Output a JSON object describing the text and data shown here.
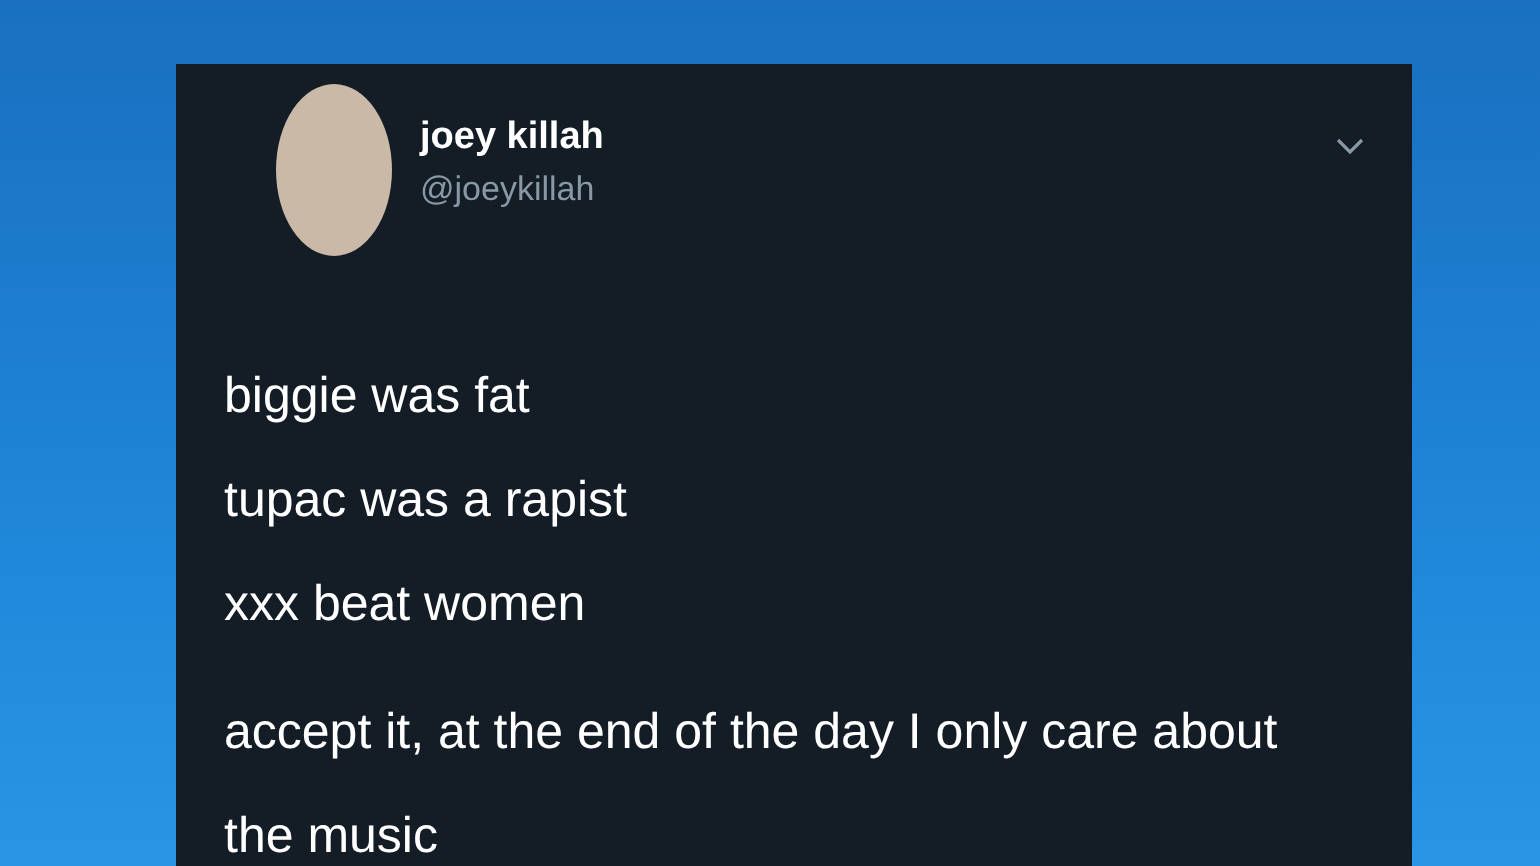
{
  "tweet": {
    "author": {
      "name": "joey killah",
      "handle": "@joeykillah"
    },
    "paragraphs": [
      {
        "lines": [
          "biggie was fat",
          "tupac was a rapist",
          "xxx beat women"
        ]
      },
      {
        "lines": [
          "accept it, at the end of the day I only care about the music"
        ]
      }
    ]
  }
}
